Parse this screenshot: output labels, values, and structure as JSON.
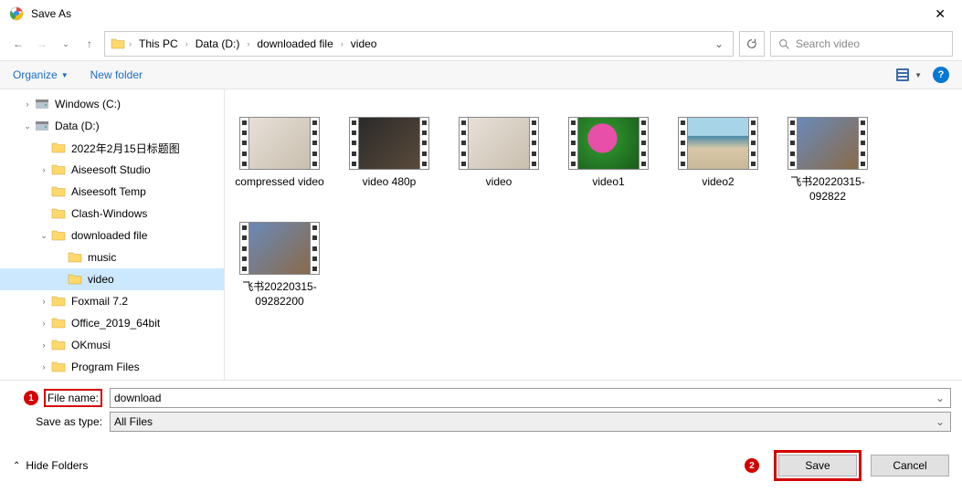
{
  "title": "Save As",
  "breadcrumbs": [
    "This PC",
    "Data (D:)",
    "downloaded file",
    "video"
  ],
  "search_placeholder": "Search video",
  "toolbar": {
    "organize": "Organize",
    "newfolder": "New folder"
  },
  "tree": [
    {
      "label": "Windows (C:)",
      "indent": 1,
      "expand": ">",
      "type": "disk"
    },
    {
      "label": "Data (D:)",
      "indent": 1,
      "expand": "v",
      "type": "disk"
    },
    {
      "label": "2022年2月15日标题图",
      "indent": 2,
      "expand": "",
      "type": "folder"
    },
    {
      "label": "Aiseesoft Studio",
      "indent": 2,
      "expand": ">",
      "type": "folder"
    },
    {
      "label": "Aiseesoft Temp",
      "indent": 2,
      "expand": "",
      "type": "folder"
    },
    {
      "label": "Clash-Windows",
      "indent": 2,
      "expand": "",
      "type": "folder"
    },
    {
      "label": "downloaded file",
      "indent": 2,
      "expand": "v",
      "type": "folder"
    },
    {
      "label": "music",
      "indent": 3,
      "expand": "",
      "type": "folder"
    },
    {
      "label": "video",
      "indent": 3,
      "expand": "",
      "type": "folder",
      "selected": true
    },
    {
      "label": "Foxmail 7.2",
      "indent": 2,
      "expand": ">",
      "type": "folder"
    },
    {
      "label": "Office_2019_64bit",
      "indent": 2,
      "expand": ">",
      "type": "folder"
    },
    {
      "label": "OKmusi",
      "indent": 2,
      "expand": ">",
      "type": "folder"
    },
    {
      "label": "Program Files",
      "indent": 2,
      "expand": ">",
      "type": "folder"
    }
  ],
  "files": [
    {
      "name": "compressed video",
      "bg": "linear-gradient(135deg,#e8e0d8,#c8bfae)"
    },
    {
      "name": "video 480p",
      "bg": "linear-gradient(135deg,#2a2a2a,#5a4a3a)"
    },
    {
      "name": "video",
      "bg": "linear-gradient(135deg,#e8e0d8,#c8bfae)"
    },
    {
      "name": "video1",
      "bg": "radial-gradient(circle at 40% 40%, #e84fa8 0%, #e84fa8 30%, #2a8a2a 32%, #1a5a1a 100%)"
    },
    {
      "name": "video2",
      "bg": "linear-gradient(180deg,#a8d4e8 0%,#a8d4e8 35%,#4a8aa8 36%,#d8c8a8 60%,#c8b898 100%)"
    },
    {
      "name": "飞书20220315-092822",
      "bg": "linear-gradient(135deg,#6a8ab8,#8a6a4a)"
    },
    {
      "name": "飞书20220315-09282200",
      "bg": "linear-gradient(135deg,#6a8ab8,#8a6a4a)"
    }
  ],
  "form": {
    "filename_label": "File name:",
    "filename_value": "download",
    "savetype_label": "Save as type:",
    "savetype_value": "All Files"
  },
  "footer": {
    "hidefolders": "Hide Folders",
    "save": "Save",
    "cancel": "Cancel"
  },
  "callouts": {
    "one": "1",
    "two": "2"
  }
}
